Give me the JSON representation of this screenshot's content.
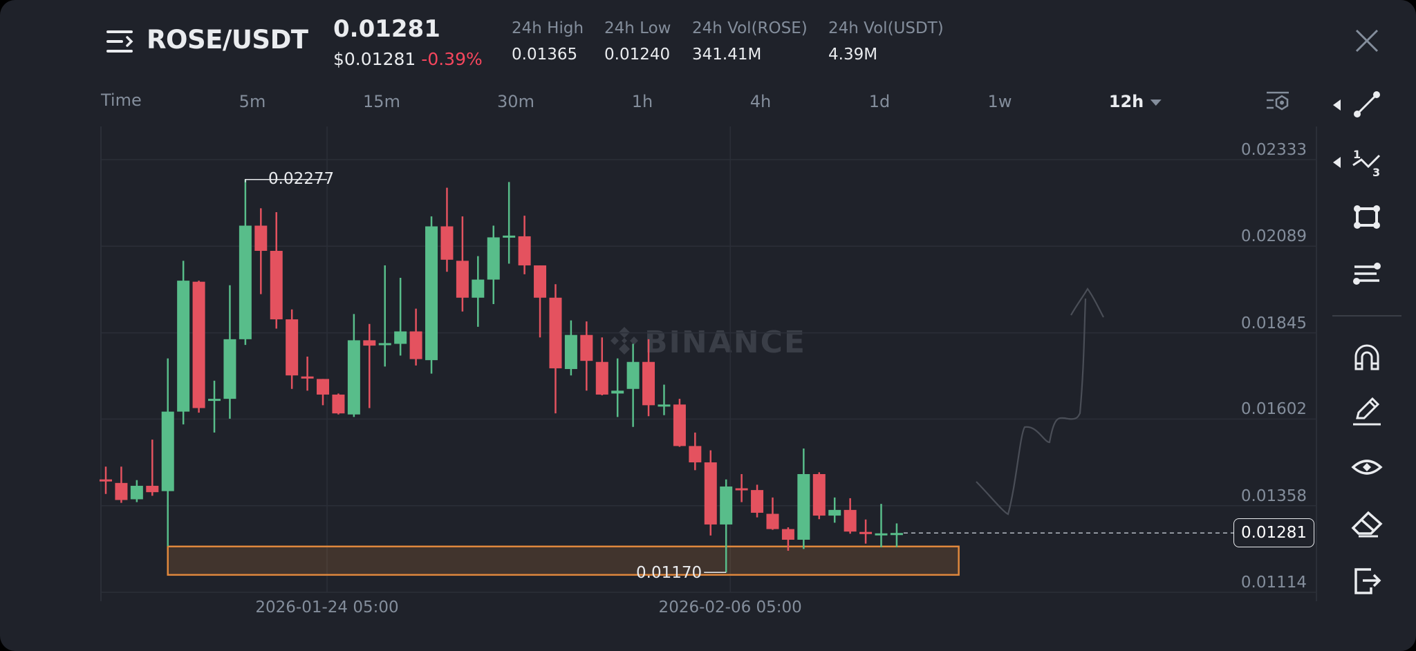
{
  "header": {
    "pair": "ROSE/USDT",
    "last_price": "0.01281",
    "usd_price": "$0.01281",
    "change_pct": "-0.39%",
    "stats": [
      {
        "label": "24h High",
        "value": "0.01365"
      },
      {
        "label": "24h Low",
        "value": "0.01240"
      },
      {
        "label": "24h Vol(ROSE)",
        "value": "341.41M"
      },
      {
        "label": "24h Vol(USDT)",
        "value": "4.39M"
      }
    ]
  },
  "timeframes": {
    "label": "Time",
    "items": [
      "5m",
      "15m",
      "30m",
      "1h",
      "4h",
      "1d",
      "1w"
    ],
    "selected": "12h"
  },
  "watermark": "BINANCE",
  "toolbar": {
    "icons": [
      "trend-line-icon",
      "fib-icon",
      "rectangle-icon",
      "parallel-lines-icon",
      "magnet-icon",
      "pencil-icon",
      "eye-icon",
      "eraser-icon",
      "exit-icon"
    ]
  },
  "colors": {
    "up": "#58bd8a",
    "down": "#e4525f",
    "background": "#1f222a",
    "zone": "#e0883d",
    "change": "#f6465d"
  },
  "chart_data": {
    "type": "candlestick",
    "interval": "12h",
    "y_ticks": [
      "0.02333",
      "0.02089",
      "0.01845",
      "0.01602",
      "0.01358",
      "0.01114"
    ],
    "ylim": [
      0.01114,
      0.02333
    ],
    "x_ticks": [
      {
        "label": "2026-01-24 05:00",
        "index": 14
      },
      {
        "label": "2026-02-06 05:00",
        "index": 40
      }
    ],
    "current_price": "0.01281",
    "high_marker": {
      "label": "0.02277",
      "index": 9,
      "value": 0.02277
    },
    "low_marker": {
      "label": "0.01170",
      "index": 40,
      "value": 0.0117
    },
    "zone": {
      "from_index": 4,
      "to_index": 55,
      "low": 0.01163,
      "high": 0.01243
    },
    "ohlc": [
      [
        0.01432,
        0.01468,
        0.01391,
        0.01427
      ],
      [
        0.01422,
        0.01468,
        0.01366,
        0.01374
      ],
      [
        0.01376,
        0.0143,
        0.01368,
        0.01414
      ],
      [
        0.01414,
        0.01544,
        0.01386,
        0.01396
      ],
      [
        0.01399,
        0.01773,
        0.01244,
        0.01623
      ],
      [
        0.01623,
        0.02048,
        0.01587,
        0.01992
      ],
      [
        0.01989,
        0.01992,
        0.0162,
        0.01633
      ],
      [
        0.01654,
        0.0171,
        0.01564,
        0.01659
      ],
      [
        0.01659,
        0.01979,
        0.01603,
        0.01827
      ],
      [
        0.01827,
        0.02277,
        0.01811,
        0.02147
      ],
      [
        0.02147,
        0.02196,
        0.01954,
        0.02076
      ],
      [
        0.02076,
        0.02185,
        0.01857,
        0.01883
      ],
      [
        0.01883,
        0.01911,
        0.01687,
        0.01725
      ],
      [
        0.01722,
        0.01778,
        0.01682,
        0.01717
      ],
      [
        0.01715,
        0.01715,
        0.01641,
        0.01671
      ],
      [
        0.01671,
        0.01674,
        0.01615,
        0.01618
      ],
      [
        0.01615,
        0.01898,
        0.01608,
        0.01824
      ],
      [
        0.01824,
        0.0187,
        0.01633,
        0.01809
      ],
      [
        0.01811,
        0.02035,
        0.0175,
        0.01816
      ],
      [
        0.01814,
        0.02,
        0.01781,
        0.01849
      ],
      [
        0.01849,
        0.01913,
        0.01753,
        0.01771
      ],
      [
        0.01768,
        0.02173,
        0.0173,
        0.02145
      ],
      [
        0.02145,
        0.02254,
        0.02017,
        0.02051
      ],
      [
        0.02048,
        0.02173,
        0.01905,
        0.01944
      ],
      [
        0.01944,
        0.02061,
        0.01862,
        0.01995
      ],
      [
        0.01995,
        0.02147,
        0.01926,
        0.02114
      ],
      [
        0.02117,
        0.0227,
        0.0204,
        0.02119
      ],
      [
        0.02117,
        0.02175,
        0.0201,
        0.02035
      ],
      [
        0.02035,
        0.02035,
        0.01832,
        0.01944
      ],
      [
        0.01944,
        0.01982,
        0.01618,
        0.01745
      ],
      [
        0.01743,
        0.0188,
        0.01725,
        0.01839
      ],
      [
        0.01839,
        0.01877,
        0.01682,
        0.01766
      ],
      [
        0.01763,
        0.01832,
        0.01669,
        0.01671
      ],
      [
        0.01674,
        0.01773,
        0.01608,
        0.01682
      ],
      [
        0.01687,
        0.01814,
        0.0158,
        0.01763
      ],
      [
        0.01763,
        0.01827,
        0.0161,
        0.01641
      ],
      [
        0.01641,
        0.01699,
        0.01613,
        0.01643
      ],
      [
        0.01643,
        0.01659,
        0.01524,
        0.01526
      ],
      [
        0.01526,
        0.01564,
        0.01458,
        0.0148
      ],
      [
        0.0148,
        0.01514,
        0.01274,
        0.01305
      ],
      [
        0.01305,
        0.01432,
        0.0117,
        0.01412
      ],
      [
        0.01407,
        0.01447,
        0.01368,
        0.01402
      ],
      [
        0.01402,
        0.01417,
        0.01325,
        0.01338
      ],
      [
        0.01335,
        0.01381,
        0.0129,
        0.01292
      ],
      [
        0.01292,
        0.01297,
        0.01231,
        0.01262
      ],
      [
        0.01262,
        0.01519,
        0.01236,
        0.01447
      ],
      [
        0.01447,
        0.01452,
        0.0132,
        0.0133
      ],
      [
        0.0133,
        0.01381,
        0.0131,
        0.01346
      ],
      [
        0.01346,
        0.01379,
        0.01279,
        0.01285
      ],
      [
        0.01284,
        0.01319,
        0.01251,
        0.01278
      ],
      [
        0.01278,
        0.01363,
        0.01241,
        0.0128
      ],
      [
        0.0128,
        0.01308,
        0.01241,
        0.01281
      ]
    ]
  }
}
